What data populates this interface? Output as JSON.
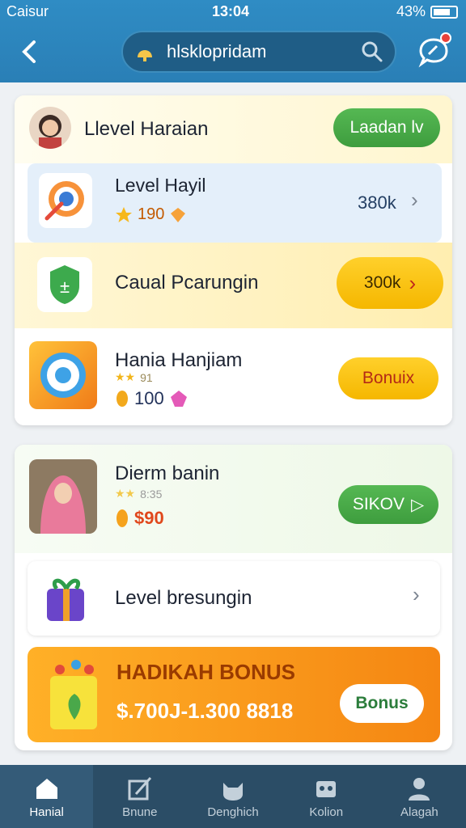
{
  "status_bar": {
    "carrier": "Caisur",
    "time": "13:04",
    "battery": "43%"
  },
  "header": {
    "search_text": "hlsklopridam"
  },
  "card1": {
    "header": {
      "title": "Llevel Haraian",
      "button": "Laadan lv"
    },
    "row_blue": {
      "title": "Level Hayil",
      "points": "190",
      "value": "380k"
    },
    "row_yellow": {
      "title": "Caual Pcarungin",
      "button": "300k"
    },
    "row_plain": {
      "title": "Hania Hanjiam",
      "rating": "91",
      "coins": "100",
      "button": "Bonuix"
    }
  },
  "card2": {
    "row_profile": {
      "title": "Dierm banin",
      "rating": "8:35",
      "coins": "$90",
      "button": "SIKOV"
    },
    "row_level": {
      "title": "Level bresungin"
    },
    "bonus": {
      "title": "HADIKAH BONUS",
      "amount": "$.700J-1.300 8818",
      "button": "Bonus"
    }
  },
  "nav": [
    {
      "label": "Hanial"
    },
    {
      "label": "Bnune"
    },
    {
      "label": "Denghich"
    },
    {
      "label": "Kolion"
    },
    {
      "label": "Alagah"
    }
  ],
  "colors": {
    "accent_blue": "#2f8cc4",
    "green": "#3e9d3e",
    "yellow": "#f5b700",
    "orange": "#f28a12"
  }
}
